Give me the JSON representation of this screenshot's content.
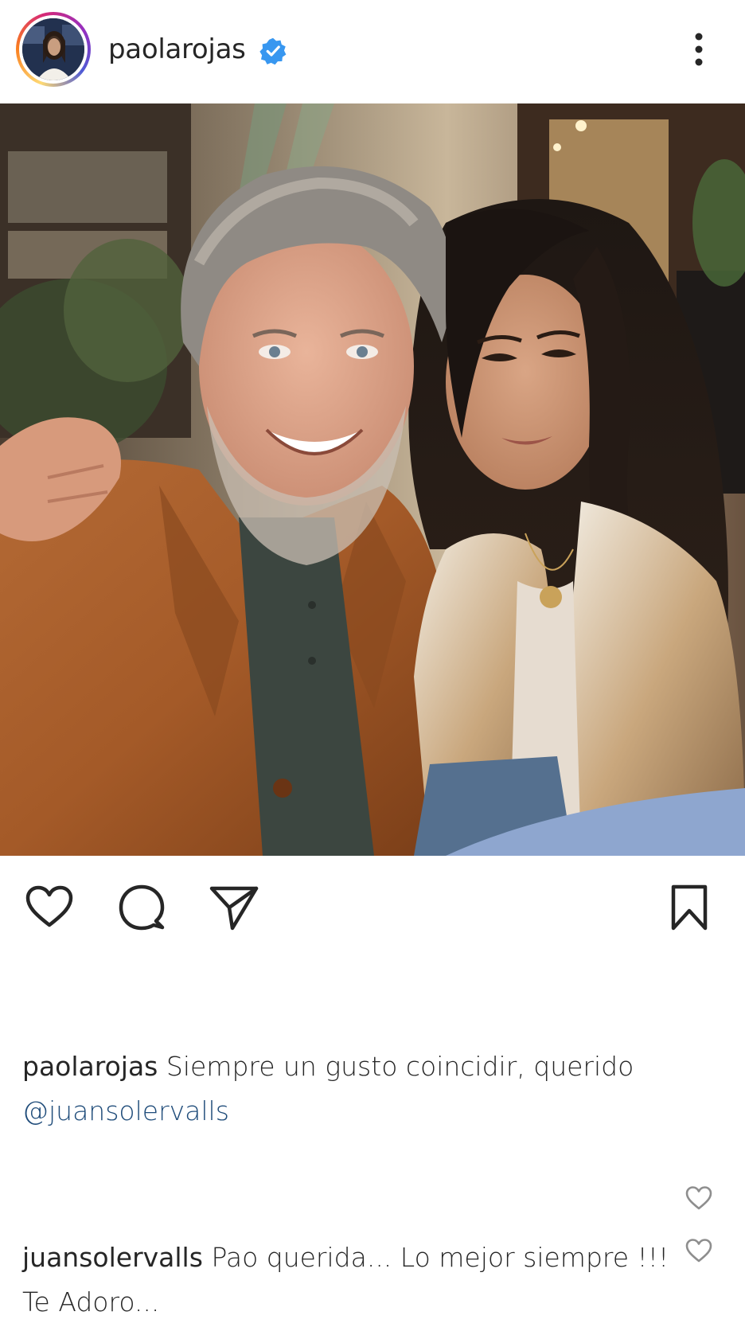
{
  "post": {
    "username": "paolarojas",
    "verified": true,
    "more_icon": "more-vertical-icon"
  },
  "image": {
    "description_alt": ""
  },
  "actions": {
    "like_icon": "heart-icon",
    "comment_icon": "comment-icon",
    "share_icon": "send-icon",
    "save_icon": "bookmark-icon"
  },
  "caption": {
    "username": "paolarojas",
    "text": "Siempre un gusto coincidir, querido",
    "mention": "@juansolervalls"
  },
  "comments": [
    {
      "username": "juansolervalls",
      "text": "Pao querida... Lo mejor siempre !!! Te Adoro..."
    }
  ],
  "colors": {
    "verified_blue": "#3897f0",
    "mention_blue": "#1f4c7a",
    "text": "#262626"
  }
}
